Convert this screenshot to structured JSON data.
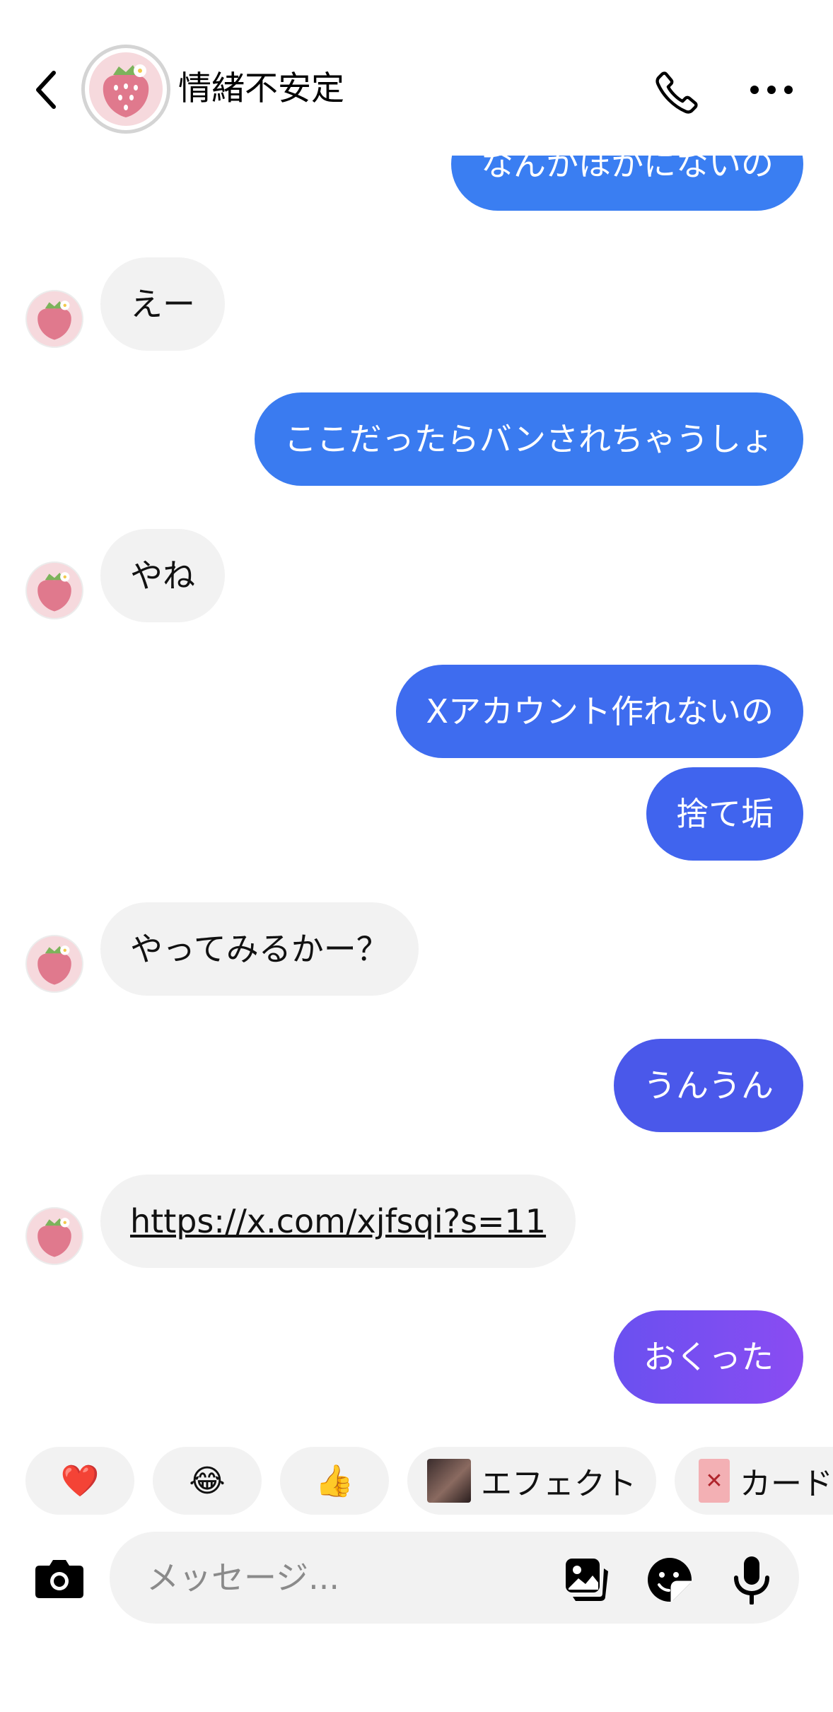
{
  "header": {
    "title": "情緒不安定"
  },
  "messages": [
    {
      "side": "out",
      "text": "なんかほかにないの"
    },
    {
      "side": "in",
      "text": "えー"
    },
    {
      "side": "out",
      "text": "ここだったらバンされちゃうしょ"
    },
    {
      "side": "in",
      "text": "やね"
    },
    {
      "side": "out",
      "text": "Xアカウント作れないの"
    },
    {
      "side": "out",
      "text": "捨て垢"
    },
    {
      "side": "in",
      "text": "やってみるかー？"
    },
    {
      "side": "out",
      "text": "うんうん"
    },
    {
      "side": "in",
      "text": "https://x.com/xjfsqi?s=11"
    },
    {
      "side": "out",
      "text": "おくった"
    }
  ],
  "quick_replies": {
    "heart": "❤️",
    "laugh": "😂",
    "thumbs_up": "👍",
    "effect_label": "エフェクト",
    "card_label": "カード"
  },
  "composer": {
    "placeholder": "メッセージ..."
  },
  "icons": {
    "back": "chevron-left-icon",
    "call": "phone-icon",
    "more": "more-horizontal-icon",
    "camera": "camera-icon",
    "gallery": "gallery-icon",
    "sticker": "sticker-icon",
    "mic": "microphone-icon"
  },
  "colors": {
    "incoming_bubble": "#f2f2f2",
    "outgoing_blue": "#3a7df0",
    "outgoing_indigo": "#4a5ae8",
    "outgoing_purple": "#7a4cf0"
  }
}
